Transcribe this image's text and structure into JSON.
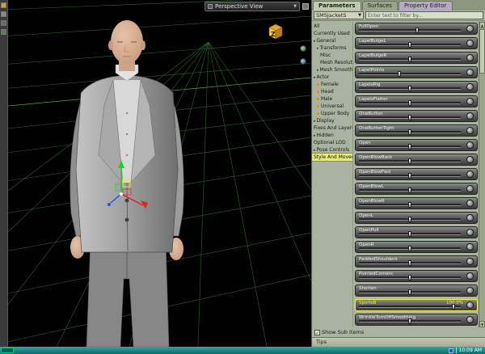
{
  "viewport": {
    "view_label": "Perspective View",
    "axis_cube_label": "Z"
  },
  "panel": {
    "tabs": [
      {
        "label": "Parameters"
      },
      {
        "label": "Surfaces"
      },
      {
        "label": "Property Editor"
      }
    ],
    "figure_select": "SMSJacketS",
    "filter_placeholder": "Enter text to filter by...",
    "nav": [
      {
        "label": "All",
        "level": 0
      },
      {
        "label": "Currently Used",
        "level": 0
      },
      {
        "label": "General",
        "level": 0,
        "arrow": true
      },
      {
        "label": "Transforms",
        "level": 1,
        "arrow": true
      },
      {
        "label": "Misc",
        "level": 2
      },
      {
        "label": "Mesh Resolution",
        "level": 2
      },
      {
        "label": "Mesh Smoothing",
        "level": 1,
        "arrow": true
      },
      {
        "label": "Actor",
        "level": 0,
        "arrow": true
      },
      {
        "label": "Female",
        "level": 1,
        "bullet": true
      },
      {
        "label": "Head",
        "level": 1,
        "bullet": true
      },
      {
        "label": "Male",
        "level": 1,
        "bullet": true
      },
      {
        "label": "Universal",
        "level": 1,
        "bullet": true
      },
      {
        "label": "Upper Body",
        "level": 1,
        "bullet": true
      },
      {
        "label": "Display",
        "level": 0,
        "arrow": true
      },
      {
        "label": "Fixes And Layering",
        "level": 0
      },
      {
        "label": "Hidden",
        "level": 0,
        "arrow": true
      },
      {
        "label": "Optional LOD",
        "level": 0
      },
      {
        "label": "Pose Controls",
        "level": 0,
        "arrow": true
      },
      {
        "label": "Style And Movement",
        "level": 0,
        "selected": true
      }
    ],
    "params": [
      {
        "name": "FullOpen",
        "pos": 57
      },
      {
        "name": "LapelBulgeL",
        "pos": 50
      },
      {
        "name": "LapelBulgeR",
        "pos": 50
      },
      {
        "name": "LapelPoints",
        "pos": 40
      },
      {
        "name": "LapelsRig",
        "pos": 50
      },
      {
        "name": "LapelsFlatter",
        "pos": 50
      },
      {
        "name": "OneButton",
        "pos": 50
      },
      {
        "name": "OneButtonTight",
        "pos": 50
      },
      {
        "name": "Open",
        "pos": 50
      },
      {
        "name": "OpenBlowBack",
        "pos": 50
      },
      {
        "name": "OpenBlowFwd",
        "pos": 50
      },
      {
        "name": "OpenBlowL",
        "pos": 50
      },
      {
        "name": "OpenBlowR",
        "pos": 50
      },
      {
        "name": "OpenL",
        "pos": 50
      },
      {
        "name": "OpenPull",
        "pos": 50
      },
      {
        "name": "OpenR",
        "pos": 50
      },
      {
        "name": "PaddedShoulders",
        "pos": 50
      },
      {
        "name": "PointedCorners",
        "pos": 50
      },
      {
        "name": "Shorten",
        "pos": 50
      },
      {
        "name": "SportsB",
        "pos": 93,
        "value": "100.0%",
        "highlight": true
      },
      {
        "name": "WrinkleTurnOffSmoothing",
        "pos": 50
      }
    ],
    "show_sub_items_label": "Show Sub Items",
    "tips_label": "Tips"
  },
  "taskbar": {
    "clock": "10:09 AM"
  },
  "colors": {
    "panel_bg": "#aab39f",
    "nav_selection": "#e6e97b",
    "param_highlight": "#ffe74a",
    "grid_green": "#356b35",
    "taskbar_teal": "#1d8b8b"
  }
}
